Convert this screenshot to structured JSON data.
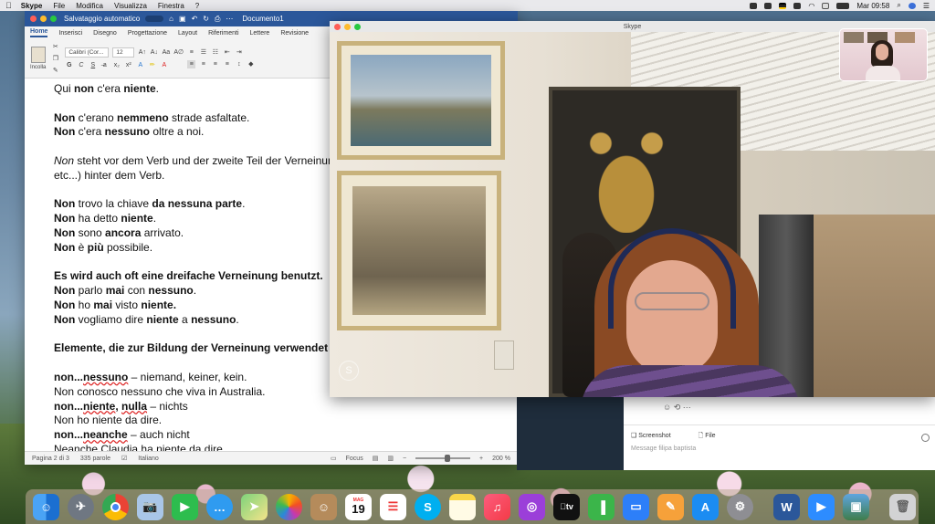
{
  "menubar": {
    "app": "Skype",
    "items": [
      "File",
      "Modifica",
      "Visualizza",
      "Finestra",
      "?"
    ],
    "clock": "Mar 09:58"
  },
  "word": {
    "autosave_label": "Salvataggio automatico",
    "doc_title": "Documento1",
    "tabs": [
      "Home",
      "Inserisci",
      "Disegno",
      "Progettazione",
      "Layout",
      "Riferimenti",
      "Lettere",
      "Revisione"
    ],
    "paste_label": "Incolla",
    "font_name": "Calibri (Cor...",
    "font_size": "12",
    "status": {
      "page": "Pagina 2 di 3",
      "words": "335 parole",
      "language": "Italiano",
      "focus": "Focus",
      "zoom": "200 %"
    }
  },
  "doc_lines": [
    {
      "html": "Qui <b>non</b> c'era <b>niente</b>."
    },
    {
      "html": ""
    },
    {
      "html": "<b>Non</b> c'erano <b>nemmeno</b> strade asfaltate."
    },
    {
      "html": "<b>Non</b> c'era <b>nessuno</b> oltre a noi."
    },
    {
      "html": ""
    },
    {
      "html": "<i>Non</i> steht vor dem Verb und der zweite Teil der Verneinung"
    },
    {
      "html": "etc...) hinter dem Verb."
    },
    {
      "html": ""
    },
    {
      "html": "<b>Non</b> trovo la chiave <b>da nessuna parte</b>."
    },
    {
      "html": "<b>Non</b> ha detto <b>niente</b>."
    },
    {
      "html": "<b>Non</b> sono <b>ancora</b> arrivato."
    },
    {
      "html": "<b>Non</b> è <b>più</b> possibile."
    },
    {
      "html": ""
    },
    {
      "html": "<b>Es wird auch oft eine dreifache Verneinung benutzt.</b>"
    },
    {
      "html": "<b>Non</b> parlo <b>mai</b> con <b>nessuno</b>."
    },
    {
      "html": "<b>Non</b> ho <b>mai</b> visto <b>niente.</b>"
    },
    {
      "html": "<b>Non</b> vogliamo dire <b>niente</b> a <b>nessuno</b>."
    },
    {
      "html": ""
    },
    {
      "html": "<b>Elemente, die zur Bildung der Verneinung verwendet werden</b>"
    },
    {
      "html": ""
    },
    {
      "html": "<b>non...<span class=\"err\">nessuno</span></b> – niemand, keiner, kein."
    },
    {
      "html": "Non conosco nessuno che viva in Australia."
    },
    {
      "html": "<b>non...<span class=\"err\">niente</span>, <span class=\"err\">nulla</span></b> – nichts"
    },
    {
      "html": "Non ho niente da dire."
    },
    {
      "html": "<b>non...<span class=\"err\">neanche</span></b> – auch nicht"
    },
    {
      "html": "Neanche Claudia ha niente da dire."
    }
  ],
  "skype": {
    "window_title": "Skype",
    "chat": {
      "screenshot_label": "Screenshot",
      "file_label": "File",
      "message_placeholder": "Message filipa  baptista"
    }
  },
  "dock": {
    "calendar_month": "MAG",
    "calendar_day": "19",
    "icons": [
      "finder-icon",
      "launchpad-icon",
      "chrome-icon",
      "preview-icon",
      "facetime-icon",
      "messages-icon",
      "maps-icon",
      "photos-icon",
      "contacts-icon",
      "calendar-icon",
      "reminders-icon",
      "skype-icon",
      "notes-icon",
      "music-icon",
      "podcasts-icon",
      "appletv-icon",
      "numbers-icon",
      "keynote-icon",
      "pages-icon",
      "appstore-icon",
      "systemprefs-icon",
      "word-icon",
      "zoom-icon",
      "imagecapture-icon",
      "trash-icon"
    ]
  }
}
